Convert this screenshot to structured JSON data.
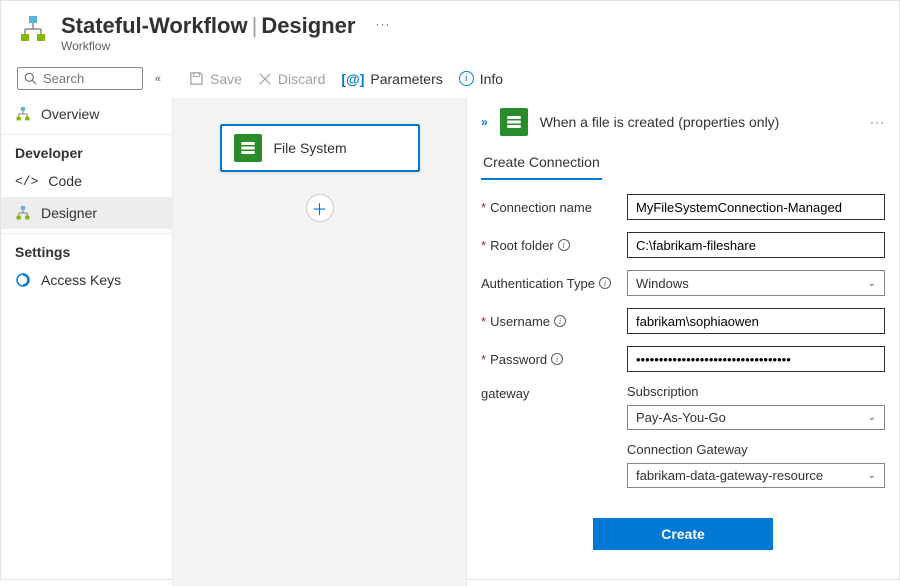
{
  "header": {
    "title_left": "Stateful-Workflow",
    "title_right": "Designer",
    "subtitle": "Workflow",
    "more": "···"
  },
  "search": {
    "placeholder": "Search"
  },
  "toolbar": {
    "save": "Save",
    "discard": "Discard",
    "parameters": "Parameters",
    "info": "Info"
  },
  "sidebar": {
    "overview": "Overview",
    "developer_header": "Developer",
    "code": "Code",
    "designer": "Designer",
    "settings_header": "Settings",
    "access_keys": "Access Keys"
  },
  "canvas": {
    "card_label": "File System"
  },
  "panel": {
    "trigger_title": "When a file is created (properties only)",
    "tab": "Create Connection",
    "more": "···",
    "fields": {
      "connection_name_label": "Connection name",
      "connection_name_value": "MyFileSystemConnection-Managed",
      "root_folder_label": "Root folder",
      "root_folder_value": "C:\\fabrikam-fileshare",
      "auth_type_label": "Authentication Type",
      "auth_type_value": "Windows",
      "username_label": "Username",
      "username_value": "fabrikam\\sophiaowen",
      "password_label": "Password",
      "password_value": "••••••••••••••••••••••••••••••••••",
      "gateway_label": "gateway",
      "subscription_label": "Subscription",
      "subscription_value": "Pay-As-You-Go",
      "conn_gateway_label": "Connection Gateway",
      "conn_gateway_value": "fabrikam-data-gateway-resource"
    },
    "create_button": "Create"
  }
}
